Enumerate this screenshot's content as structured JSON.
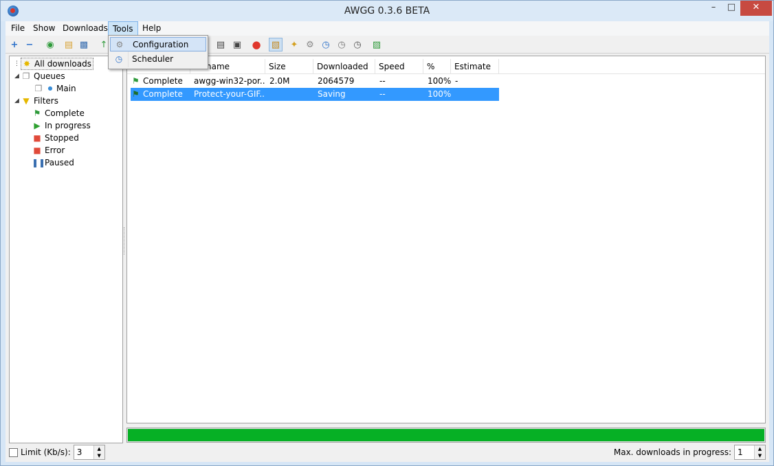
{
  "window": {
    "title": "AWGG 0.3.6 BETA"
  },
  "menu": [
    "File",
    "Show",
    "Downloads",
    "Tools",
    "Help"
  ],
  "tools_menu": {
    "items": [
      "Configuration",
      "Scheduler"
    ]
  },
  "tree": {
    "all_downloads": "All downloads",
    "queues": "Queues",
    "main": "Main",
    "filters": "Filters",
    "complete": "Complete",
    "in_progress": "In progress",
    "stopped": "Stopped",
    "error": "Error",
    "paused": "Paused"
  },
  "list": {
    "columns": [
      "name",
      "Size",
      "Downloaded",
      "Speed",
      "%",
      "Estimate"
    ],
    "rows": [
      {
        "status": "Complete",
        "name": "awgg-win32-por...",
        "size": "2.0M",
        "downloaded": "2064579",
        "speed": "--",
        "percent": "100%",
        "estimate": "-"
      },
      {
        "status": "Complete",
        "name": "Protect-your-GIF...",
        "size": "",
        "downloaded": "Saving",
        "speed": "--",
        "percent": "100%",
        "estimate": ""
      }
    ]
  },
  "progress": {
    "value": 1.0,
    "color": "#06b025"
  },
  "status": {
    "limit_label": "Limit (Kb/s):",
    "limit_value": "3",
    "max_label": "Max. downloads in progress:",
    "max_value": "1"
  },
  "colors": {
    "selection": "#3399ff",
    "close_button": "#c74a41"
  }
}
